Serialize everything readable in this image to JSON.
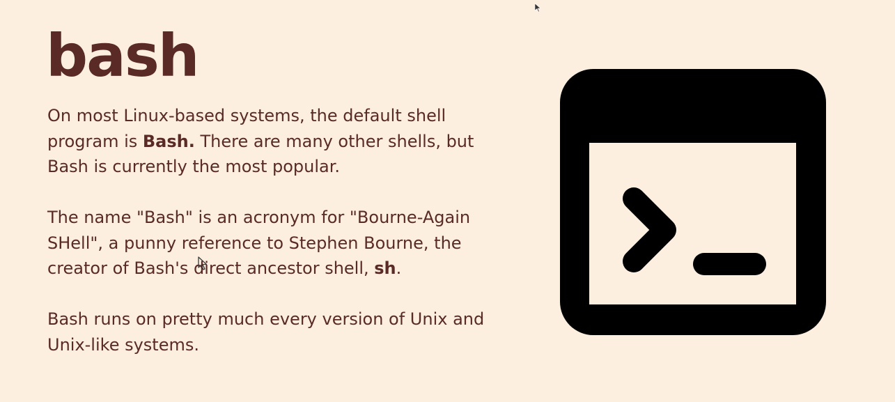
{
  "slide": {
    "title": "bash",
    "paragraphs": [
      {
        "lines": [
          [
            "On most Linux-based systems, the default shell"
          ],
          [
            "program is ",
            {
              "b": "Bash."
            },
            "  There are many other shells, but"
          ],
          [
            "Bash is currently the most popular."
          ]
        ]
      },
      {
        "lines": [
          [
            "The name \"Bash\" is an acronym for \"Bourne-Again"
          ],
          [
            "SHell\", a punny reference to Stephen Bourne, the"
          ],
          [
            "creator of Bash's direct ancestor shell, ",
            {
              "b": "sh"
            },
            "."
          ]
        ]
      },
      {
        "lines": [
          [
            "Bash runs on pretty much every version of Unix and"
          ],
          [
            "Unix-like systems."
          ]
        ]
      }
    ],
    "icon": "terminal-icon",
    "colors": {
      "background": "#FDEFDF",
      "text": "#5A2A27",
      "icon": "#000000"
    }
  }
}
